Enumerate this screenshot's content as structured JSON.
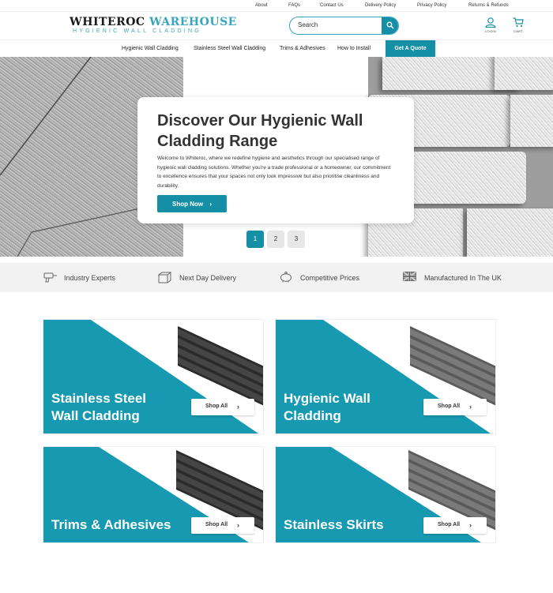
{
  "utility_links": [
    "About",
    "FAQs",
    "Contact Us",
    "Delivery Policy",
    "Privacy Policy",
    "Returns & Refunds"
  ],
  "brand": {
    "name_part1": "WHITEROC",
    "name_part2": "WAREHOUSE",
    "tagline": "HYGIENIC WALL CLADDING"
  },
  "search": {
    "placeholder": "Search"
  },
  "header_icons": {
    "login": "LOGIN",
    "cart": "CART"
  },
  "nav": {
    "items": [
      "Hygienic Wall Cladding",
      "Stainless Steel Wall Cladding",
      "Trims & Adhesives",
      "How to Install"
    ],
    "cta": "Get A Quote"
  },
  "hero": {
    "title": "Discover Our Hygienic Wall Cladding Range",
    "body": "Welcome to Whiteroc, where we redefine hygiene and aesthetics through our specialised range of hygienic wall cladding solutions. Whether you're a trade professional or a homeowner, our commitment to excellence ensures that your spaces not only look impressive but also prioritise cleanliness and durability.",
    "button": "Shop Now",
    "slides": [
      "1",
      "2",
      "3"
    ],
    "active_slide": "1"
  },
  "features": [
    "Industry Experts",
    "Next Day Delivery",
    "Competitive Prices",
    "Manufactured In The UK"
  ],
  "categories": [
    {
      "title_line1": "Stainless Steel",
      "title_line2": "Wall Cladding",
      "button": "Shop All"
    },
    {
      "title_line1": "Hygienic Wall",
      "title_line2": "Cladding",
      "button": "Shop All"
    },
    {
      "title_line1": "Trims & Adhesives",
      "title_line2": "",
      "button": "Shop All"
    },
    {
      "title_line1": "Stainless Skirts",
      "title_line2": "",
      "button": "Shop All"
    }
  ],
  "colors": {
    "accent": "#158fa5",
    "tile_teal": "#1799b1",
    "logo_accent": "#37a6bd"
  }
}
